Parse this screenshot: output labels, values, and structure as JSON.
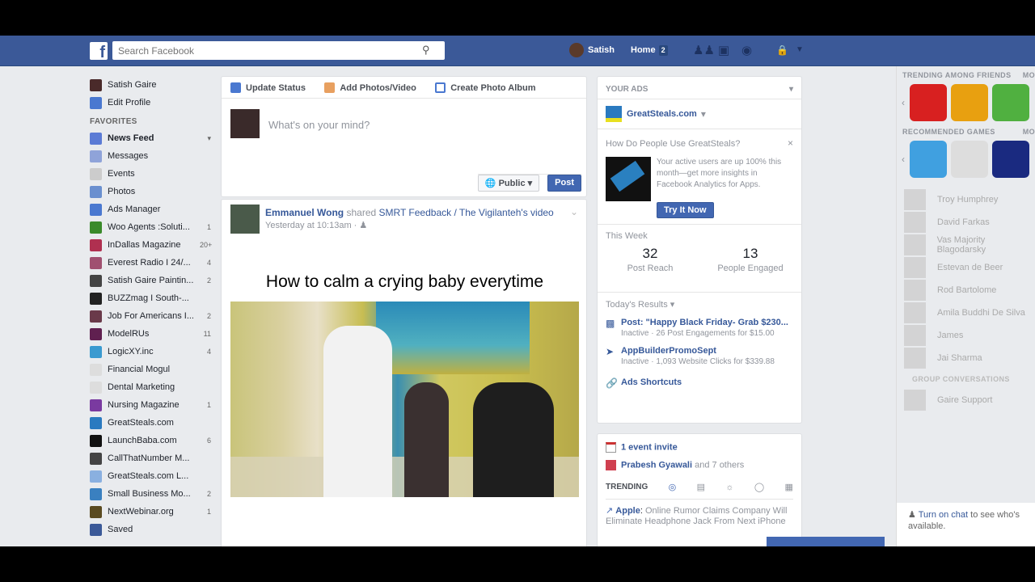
{
  "topbar": {
    "search_placeholder": "Search Facebook",
    "user": "Satish",
    "home": "Home",
    "home_badge": "2"
  },
  "sidebar": {
    "profile_name": "Satish Gaire",
    "edit_profile": "Edit Profile",
    "favorites_heading": "FAVORITES",
    "items": [
      {
        "label": "News Feed",
        "count": "▾",
        "color": "#5b7bd5"
      },
      {
        "label": "Messages",
        "count": "",
        "color": "#8fa3d9"
      },
      {
        "label": "Events",
        "count": "",
        "color": "#ccc"
      },
      {
        "label": "Photos",
        "count": "",
        "color": "#6a8fcf"
      },
      {
        "label": "Ads Manager",
        "count": "",
        "color": "#4a78d0"
      },
      {
        "label": "Woo Agents :Soluti...",
        "count": "1",
        "color": "#3a8a2a"
      },
      {
        "label": "InDallas Magazine",
        "count": "20+",
        "color": "#b03050"
      },
      {
        "label": "Everest Radio I 24/...",
        "count": "4",
        "color": "#a05070"
      },
      {
        "label": "Satish Gaire Paintin...",
        "count": "2",
        "color": "#444"
      },
      {
        "label": "BUZZmag I South-...",
        "count": "",
        "color": "#222"
      },
      {
        "label": "Job For Americans I...",
        "count": "2",
        "color": "#6a3a4a"
      },
      {
        "label": "ModelRUs",
        "count": "11",
        "color": "#602050"
      },
      {
        "label": "LogicXY.inc",
        "count": "4",
        "color": "#3a9ad0"
      },
      {
        "label": "Financial Mogul",
        "count": "",
        "color": "#ddd"
      },
      {
        "label": "Dental Marketing",
        "count": "",
        "color": "#ddd"
      },
      {
        "label": "Nursing Magazine",
        "count": "1",
        "color": "#7a3aa0"
      },
      {
        "label": "GreatSteals.com",
        "count": "",
        "color": "#2a7ac0"
      },
      {
        "label": "LaunchBaba.com",
        "count": "6",
        "color": "#111"
      },
      {
        "label": "CallThatNumber M...",
        "count": "",
        "color": "#444"
      },
      {
        "label": "GreatSteals.com L...",
        "count": "",
        "color": "#8ab0e0"
      },
      {
        "label": "Small Business Mo...",
        "count": "2",
        "color": "#3a80c0"
      },
      {
        "label": "NextWebinar.org",
        "count": "1",
        "color": "#5a4a20"
      },
      {
        "label": "Saved",
        "count": "",
        "color": "#3b5998"
      }
    ]
  },
  "composer": {
    "tab_status": "Update Status",
    "tab_photos": "Add Photos/Video",
    "tab_album": "Create Photo Album",
    "placeholder": "What's on your mind?",
    "audience": "Public",
    "post": "Post"
  },
  "post": {
    "author": "Emmanuel Wong",
    "action": "shared",
    "source": "SMRT Feedback / The Vigilanteh's",
    "suffix": "video",
    "time": "Yesterday at 10:13am",
    "video_title": "How to calm a crying baby everytime"
  },
  "ads": {
    "heading": "YOUR ADS",
    "page": "GreatSteals.com",
    "promo_title": "How Do People Use GreatSteals?",
    "promo_text": "Your active users are up 100% this month—get more insights in Facebook Analytics for Apps.",
    "try_now": "Try It Now",
    "this_week": "This Week",
    "reach_value": "32",
    "reach_label": "Post Reach",
    "engaged_value": "13",
    "engaged_label": "People Engaged",
    "results_heading": "Today's Results",
    "results": [
      {
        "title": "Post: \"Happy Black Friday- Grab $230...",
        "detail": "Inactive · 26 Post Engagements for $15.00"
      },
      {
        "title": "AppBuilderPromoSept",
        "detail": "Inactive · 1,093 Website Clicks for $339.88"
      }
    ],
    "shortcuts": "Ads Shortcuts"
  },
  "events": {
    "invite": "1 event invite",
    "birthday_name": "Prabesh Gyawali",
    "birthday_rest": "and 7 others",
    "trending": "TRENDING",
    "trend_topic": "Apple",
    "trend_text": "Online Rumor Claims Company Will Eliminate Headphone Jack From Next iPhone"
  },
  "rail": {
    "trending_games": "TRENDING AMONG FRIENDS",
    "recommended": "RECOMMENDED GAMES",
    "more": "MO",
    "friends": [
      "Troy Humphrey",
      "David Farkas",
      "Vas Majority Blagodarsky",
      "Estevan de Beer",
      "Rod Bartolome",
      "Amila Buddhi De Silva",
      "James",
      "Jai Sharma"
    ],
    "group_heading": "GROUP CONVERSATIONS",
    "group_name": "Gaire Support",
    "chat_link": "Turn on chat",
    "chat_rest": "to see who's available."
  }
}
